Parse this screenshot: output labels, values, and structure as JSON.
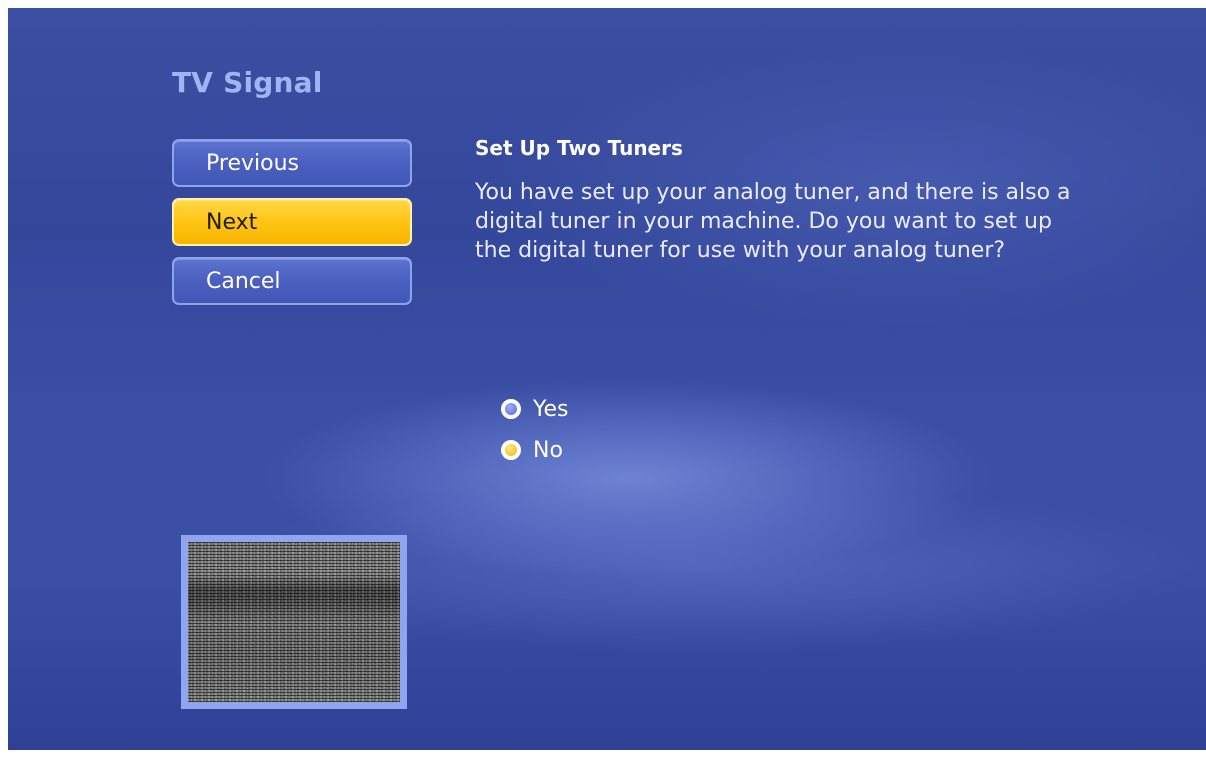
{
  "page": {
    "title": "TV Signal"
  },
  "nav": {
    "previous_label": "Previous",
    "next_label": "Next",
    "cancel_label": "Cancel"
  },
  "content": {
    "heading": "Set Up Two Tuners",
    "body": "You have set up your analog tuner, and there is also a digital tuner in your machine. Do you want to set up the digital tuner for use with your analog tuner?"
  },
  "options": {
    "yes_label": "Yes",
    "no_label": "No",
    "selected": "No"
  },
  "preview": {
    "icon": "tv-static-preview"
  },
  "colors": {
    "accent_focus": "#ffc412",
    "button_blue": "#4a5fbf",
    "title_color": "#9fb4f0"
  }
}
